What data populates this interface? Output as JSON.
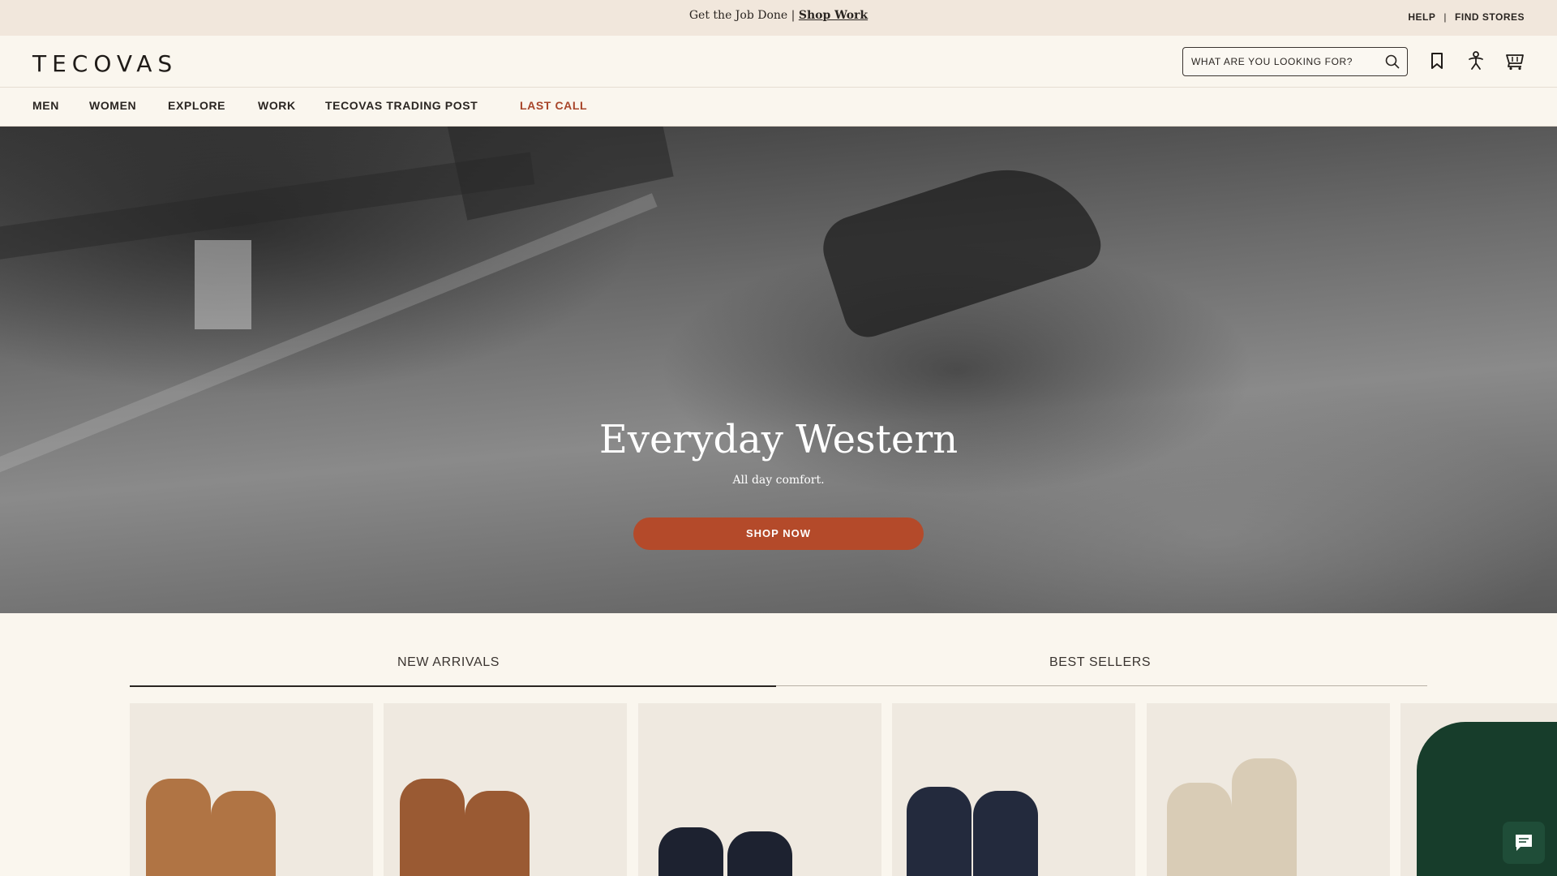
{
  "promo": {
    "text": "Get the Job Done |",
    "link": "Shop Work"
  },
  "utility": {
    "help": "HELP",
    "separator": "|",
    "find_stores": "FIND STORES"
  },
  "header": {
    "logo": "TECOVAS",
    "search_placeholder": "WHAT ARE YOU LOOKING FOR?"
  },
  "nav": {
    "items": [
      {
        "label": "MEN"
      },
      {
        "label": "WOMEN"
      },
      {
        "label": "EXPLORE"
      },
      {
        "label": "WORK"
      },
      {
        "label": "TECOVAS TRADING POST"
      },
      {
        "label": "LAST CALL"
      }
    ]
  },
  "hero": {
    "title": "Everyday Western",
    "subtitle": "All day comfort.",
    "cta": "SHOP NOW"
  },
  "tabs": {
    "items": [
      {
        "label": "NEW ARRIVALS"
      },
      {
        "label": "BEST SELLERS"
      }
    ],
    "active": "NEW ARRIVALS"
  },
  "products": {
    "items": [
      {
        "color": "#b07444"
      },
      {
        "color": "#9a5a33"
      },
      {
        "color": "#1d2230"
      },
      {
        "color": "#232a3d"
      },
      {
        "color": "#d9ccb6"
      },
      {
        "color": "#173d2b"
      }
    ]
  },
  "colors": {
    "accent": "#b44a2a",
    "sale": "#a8452a",
    "background": "#faf6ee",
    "promo_bar": "#f1e7dc"
  }
}
